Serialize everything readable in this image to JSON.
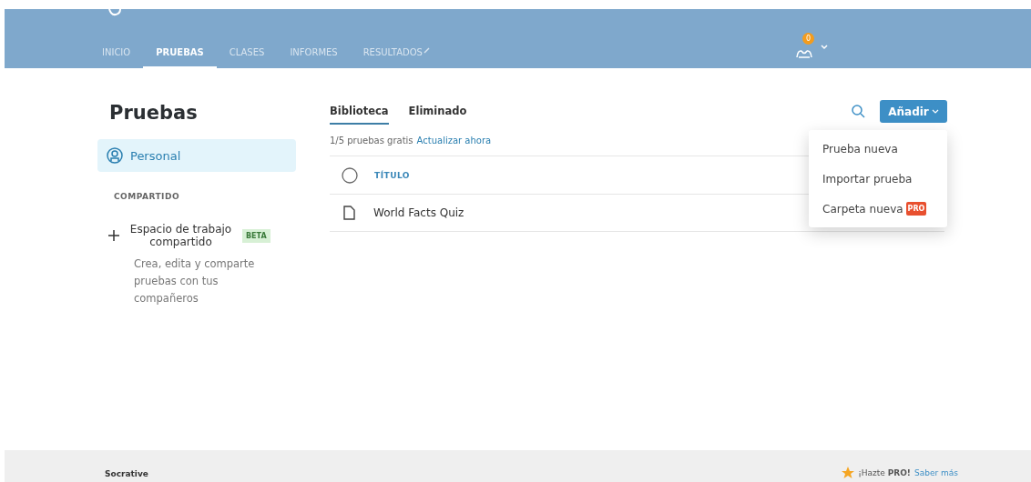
{
  "header": {
    "tabs": [
      {
        "label": "INICIO",
        "selected": false
      },
      {
        "label": "PRUEBAS",
        "selected": true
      },
      {
        "label": "CLASES",
        "selected": false
      },
      {
        "label": "INFORMES",
        "selected": false
      },
      {
        "label": "RESULTADOS",
        "selected": false
      }
    ],
    "notification_count": "0"
  },
  "sidebar": {
    "title": "Pruebas",
    "items": [
      {
        "label": "Personal",
        "selected": true
      }
    ],
    "section_label": "COMPARTIDO",
    "shared_workspace": {
      "label": "Espacio de trabajo compartido",
      "badge": "BETA",
      "description": "Crea, edita y comparte pruebas con tus compañeros"
    }
  },
  "library": {
    "tabs": [
      {
        "label": "Biblioteca",
        "selected": true
      },
      {
        "label": "Eliminado",
        "selected": false
      }
    ],
    "quota_text": "1/5 pruebas gratis",
    "upgrade_link": "Actualizar ahora",
    "columns": [
      {
        "label": "TÍTULO",
        "checked": false
      }
    ],
    "rows": [
      {
        "title": "World Facts Quiz"
      }
    ]
  },
  "actions": {
    "add_button": "Añadir",
    "menu": [
      {
        "label": "Prueba nueva"
      },
      {
        "label": "Importar prueba"
      },
      {
        "label": "Carpeta nueva",
        "badge": "PRO"
      }
    ]
  },
  "footer": {
    "brand": "Socrative",
    "promo": "¡Hazte **PRO!**",
    "link": "Saber más"
  }
}
